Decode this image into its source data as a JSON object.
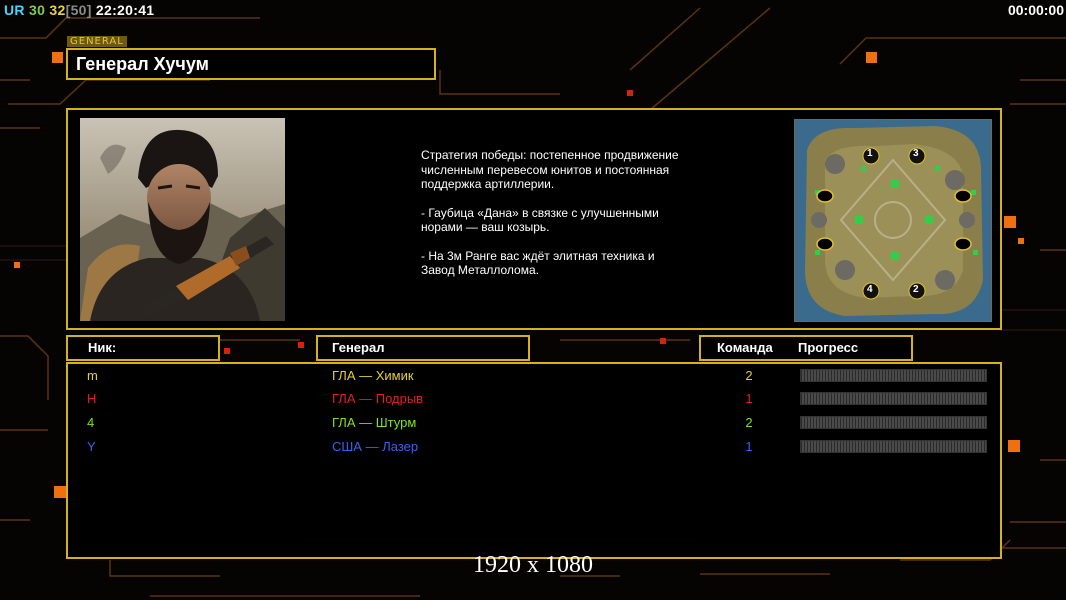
{
  "hud": {
    "tag": "UR",
    "num1": "30",
    "num2": "32",
    "bracket": "[50]",
    "clock": "22:20:41",
    "timer": "00:00:00"
  },
  "general": {
    "tag": "GENERAL",
    "name": "Генерал Хучум"
  },
  "strategy": {
    "p1": "Стратегия победы: постепенное продвижение численным перевесом юнитов и постоянная поддержка артиллерии.",
    "p2": "- Гаубица «Дана» в связке с улучшенными норами — ваш козырь.",
    "p3": "- На 3м Ранге вас ждёт элитная техника и Завод Металлолома."
  },
  "minimap": {
    "slots": [
      "1",
      "3",
      "4",
      "2"
    ]
  },
  "headers": {
    "nick": "Ник:",
    "general": "Генерал",
    "team": "Команда",
    "progress": "Прогресс"
  },
  "players": [
    {
      "nick": "m",
      "general": "ГЛА — Химик",
      "team": "2",
      "color": "#e4d02c"
    },
    {
      "nick": "H",
      "general": "ГЛА — Подрыв",
      "team": "1",
      "color": "#e0221e"
    },
    {
      "nick": "4",
      "general": "ГЛА — Штурм",
      "team": "2",
      "color": "#86e01a"
    },
    {
      "nick": "Y",
      "general": "США — Лазер",
      "team": "1",
      "color": "#3a62f0"
    }
  ],
  "resolution": "1920 x 1080",
  "colors": {
    "accent": "#d3b21d",
    "tag_ur": "#46d6ff",
    "tag_30": "#7ad04a",
    "tag_32": "#e6d34a",
    "bracket": "#8a8a8a",
    "deco_orange": "#f07010",
    "deco_red": "#d8200c"
  }
}
